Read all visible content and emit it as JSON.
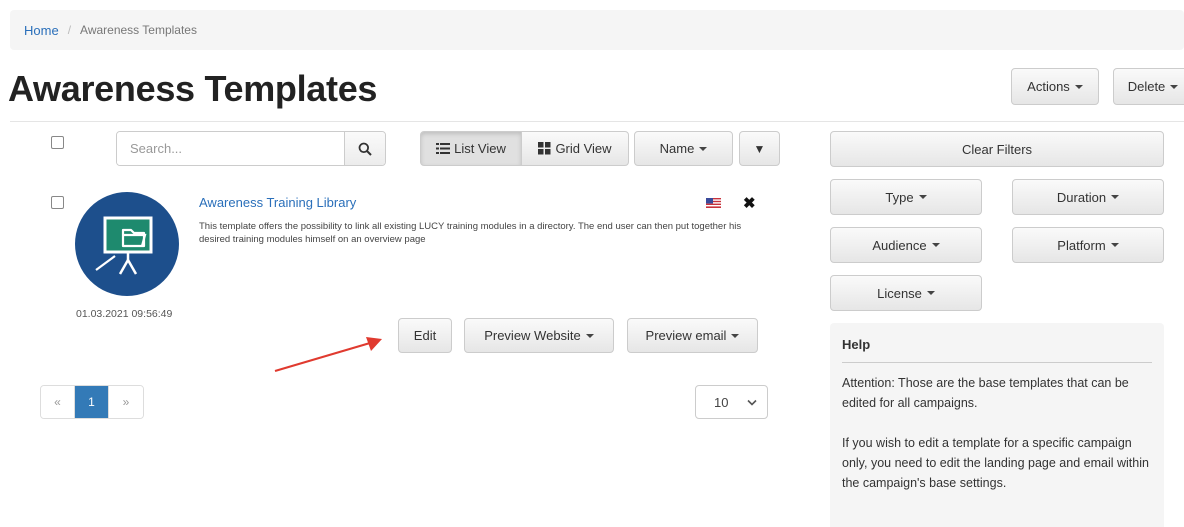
{
  "breadcrumb": {
    "home": "Home",
    "separator": "/",
    "current": "Awareness Templates"
  },
  "page_title": "Awareness Templates",
  "header_actions": {
    "actions_label": "Actions",
    "delete_label": "Delete"
  },
  "toolbar": {
    "search_placeholder": "Search...",
    "list_view_label": "List View",
    "grid_view_label": "Grid View",
    "sort_label": "Name",
    "sort_direction_icon": "▼"
  },
  "item": {
    "title": "Awareness Training Library",
    "description": "This template offers the possibility to link all existing LUCY training modules in a directory. The end user can then put together his desired training modules himself on an overview page",
    "date": "01.03.2021 09:56:49",
    "language_flag": "us-flag-icon",
    "remove_icon": "✖",
    "edit_label": "Edit",
    "preview_website_label": "Preview Website",
    "preview_email_label": "Preview email"
  },
  "pagination": {
    "prev": "«",
    "current": "1",
    "next": "»"
  },
  "per_page": {
    "value": "10"
  },
  "filters": {
    "clear_label": "Clear Filters",
    "type_label": "Type",
    "duration_label": "Duration",
    "audience_label": "Audience",
    "platform_label": "Platform",
    "license_label": "License"
  },
  "help": {
    "title": "Help",
    "paragraph1": "Attention: Those are the base templates that can be edited for all campaigns.",
    "paragraph2": "If you wish to edit a template for a specific campaign only, you need to edit the landing page and email within the campaign's base settings."
  },
  "colors": {
    "link": "#2a6fba",
    "primary": "#337ab7",
    "logo_bg": "#1d4f8c",
    "logo_screen": "#1e8a6e",
    "annotation_arrow": "#e03a2f"
  }
}
